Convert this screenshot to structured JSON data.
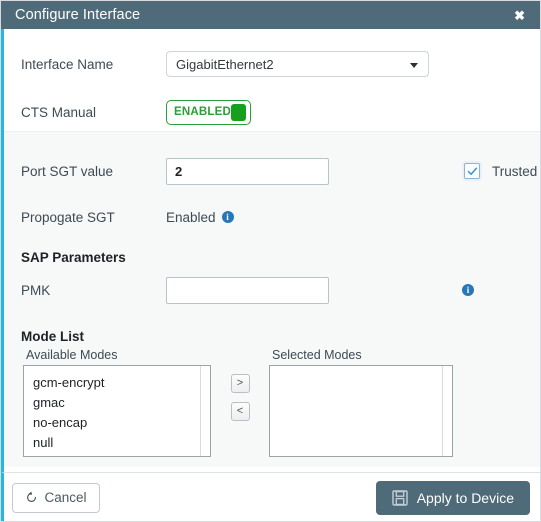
{
  "window": {
    "title": "Configure Interface",
    "close_label": "✖",
    "accent_color": "#26b7e0",
    "titlebar_color": "#4f6b7a"
  },
  "form": {
    "interface_name": {
      "label": "Interface Name",
      "value": "GigabitEthernet2",
      "options": [
        "GigabitEthernet2"
      ]
    },
    "cts_manual": {
      "label": "CTS Manual",
      "state_label": "ENABLED",
      "on_color": "#17a01e"
    },
    "port_sgt": {
      "label": "Port SGT value",
      "value": "2",
      "placeholder": ""
    },
    "trusted": {
      "label": "Trusted",
      "checked": true
    },
    "propogate_sgt": {
      "label": "Propogate SGT",
      "value": "Enabled",
      "info": "i"
    }
  },
  "sap": {
    "heading": "SAP Parameters",
    "pmk": {
      "label": "PMK",
      "value": "",
      "placeholder": "",
      "info": "i"
    }
  },
  "mode_list": {
    "heading": "Mode List",
    "available": {
      "caption": "Available Modes",
      "items": [
        "gcm-encrypt",
        "gmac",
        "no-encap",
        "null"
      ]
    },
    "selected": {
      "caption": "Selected Modes",
      "items": []
    },
    "add_label": ">",
    "remove_label": "<"
  },
  "footer": {
    "cancel_label": "Cancel",
    "apply_label": "Apply to Device"
  }
}
